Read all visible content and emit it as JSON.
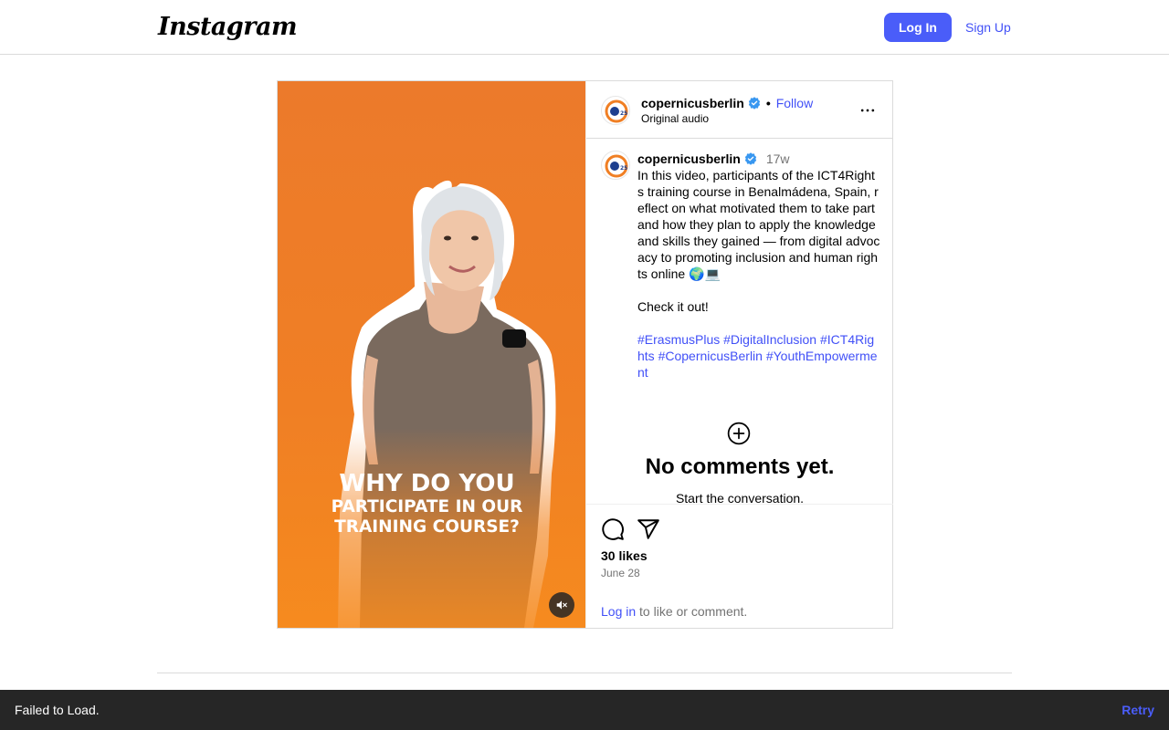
{
  "topbar": {
    "logo": "Instagram",
    "login_label": "Log In",
    "signup_label": "Sign Up"
  },
  "post": {
    "media": {
      "overlay_line1": "WHY DO YOU",
      "overlay_line2": "PARTICIPATE IN OUR",
      "overlay_line3": "TRAINING COURSE?",
      "muted": true
    },
    "header": {
      "username": "copernicusberlin",
      "verified": true,
      "separator": "•",
      "follow_label": "Follow",
      "audio": "Original audio"
    },
    "caption": {
      "username": "copernicusberlin",
      "time": "17w",
      "text": "In this video, participants of the ICT4Rights training course in Benalmádena, Spain, reflect on what motivated them to take part and how they plan to apply the knowledge and skills they gained — from digital advocacy to promoting inclusion and human rights online 🌍💻\n\nCheck it out!\n\n",
      "hashtags": "#ErasmusPlus #DigitalInclusion #ICT4Rights #CopernicusBerlin #YouthEmpowerment"
    },
    "no_comments": {
      "title": "No comments yet.",
      "subtitle": "Start the conversation."
    },
    "actions": {
      "likes": "30 likes",
      "date": "June 28",
      "login_link": "Log in",
      "login_suffix": " to like or comment."
    }
  },
  "toast": {
    "message": "Failed to Load.",
    "retry_label": "Retry"
  },
  "colors": {
    "accent": "#4a5df9",
    "link": "#4150f7",
    "media_orange": "#f07f24",
    "toast_bg": "#262626"
  },
  "icons": {
    "verified": "verified-badge-icon",
    "more": "more-options-icon",
    "add_comment": "add-circle-icon",
    "comment": "comment-icon",
    "share": "share-icon",
    "mute": "speaker-muted-icon"
  }
}
